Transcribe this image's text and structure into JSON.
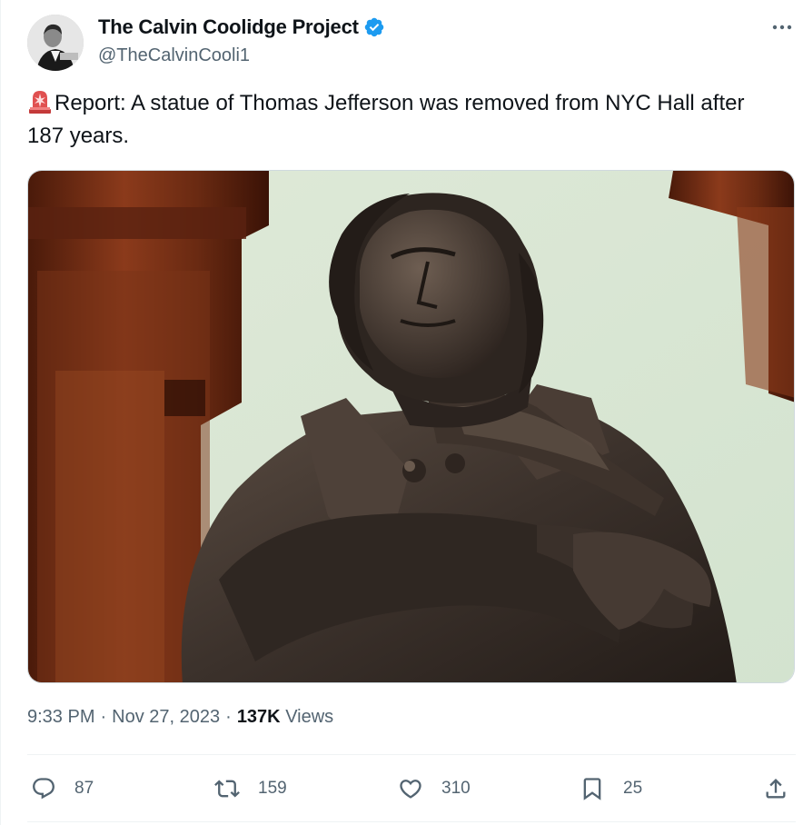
{
  "account": {
    "display_name": "The Calvin Coolidge Project",
    "handle": "@TheCalvinCooli1",
    "verified": true,
    "avatar_icon": "avatar-photo-bw-portrait"
  },
  "tweet": {
    "emoji_icon": "police-siren-icon",
    "text": "Report: A statue of Thomas Jefferson was removed from NYC Hall after 187 years.",
    "media": {
      "description_icon": "bronze-statue-photo"
    }
  },
  "meta": {
    "time": "9:33 PM",
    "date": "Nov 27, 2023",
    "views_count": "137K",
    "views_label": "Views",
    "separator": "·"
  },
  "actions": {
    "replies": "87",
    "reposts": "159",
    "likes": "310",
    "bookmarks": "25"
  },
  "colors": {
    "text_primary": "#0f1419",
    "text_secondary": "#536471",
    "verified_blue": "#1d9bf0",
    "border": "#cfd9de"
  }
}
